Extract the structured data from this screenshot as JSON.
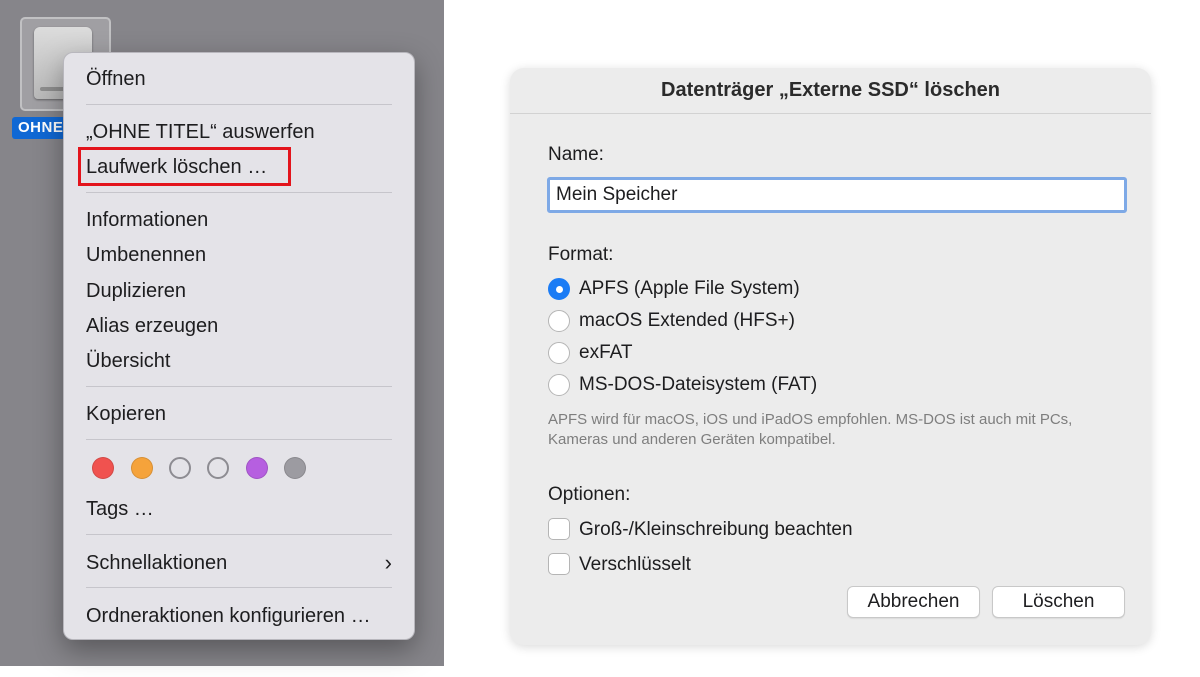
{
  "desktop": {
    "drive_label": "OHNE"
  },
  "context_menu": {
    "items": [
      "Öffnen",
      "„OHNE TITEL“ auswerfen",
      "Laufwerk löschen …",
      "Informationen",
      "Umbenennen",
      "Duplizieren",
      "Alias erzeugen",
      "Übersicht",
      "Kopieren",
      "Tags …",
      "Schnellaktionen",
      "Ordneraktionen konfigurieren …"
    ],
    "submenu_chevron": "›",
    "highlight_color": "#e3141c",
    "tag_colors": [
      "#f0524f",
      "#f5a33b",
      "#e4e3e8",
      "#e4e3e8",
      "#b65fe0",
      "#9c9ba1"
    ],
    "tag_names": [
      "red",
      "orange",
      "none",
      "none",
      "purple",
      "gray"
    ]
  },
  "dialog": {
    "title": "Datenträger „Externe SSD“ löschen",
    "name_label": "Name:",
    "name_value": "Mein Speicher",
    "format_label": "Format:",
    "format_options": [
      "APFS (Apple File System)",
      "macOS Extended (HFS+)",
      "exFAT",
      "MS-DOS-Dateisystem (FAT)"
    ],
    "selected_format": "APFS (Apple File System)",
    "hint": "APFS wird für macOS, iOS und iPadOS empfohlen. MS-DOS ist auch mit PCs, Kameras und anderen Geräten kompatibel.",
    "options_label": "Optionen:",
    "options": [
      "Groß-/Kleinschreibung beachten",
      "Verschlüsselt"
    ],
    "cancel_label": "Abbrechen",
    "erase_label": "Löschen",
    "accent_color": "#1b7cf5"
  }
}
